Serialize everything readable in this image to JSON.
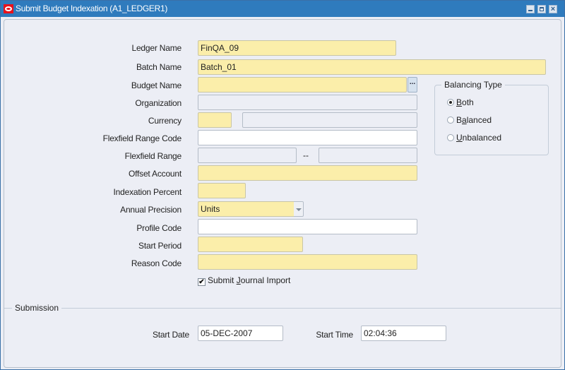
{
  "window": {
    "title": "Submit Budget Indexation (A1_LEDGER1)",
    "buttons": {
      "minimize": "minimize",
      "maximize": "maximize",
      "close": "×"
    }
  },
  "form": {
    "ledger_name": {
      "label": "Ledger Name",
      "value": "FinQA_09"
    },
    "batch_name": {
      "label": "Batch Name",
      "value": "Batch_01"
    },
    "budget_name": {
      "label": "Budget Name",
      "value": "",
      "lov_label": "..."
    },
    "organization": {
      "label": "Organization",
      "value": ""
    },
    "currency": {
      "label": "Currency",
      "value": "",
      "description": ""
    },
    "flexfield_range_code": {
      "label": "Flexfield Range Code",
      "value": ""
    },
    "flexfield_range": {
      "label": "Flexfield Range",
      "from": "",
      "separator": "--",
      "to": ""
    },
    "offset_account": {
      "label": "Offset Account",
      "value": ""
    },
    "indexation_percent": {
      "label": "Indexation Percent",
      "value": ""
    },
    "annual_precision": {
      "label": "Annual Precision",
      "value": "Units"
    },
    "profile_code": {
      "label": "Profile Code",
      "value": ""
    },
    "start_period": {
      "label": "Start Period",
      "value": ""
    },
    "reason_code": {
      "label": "Reason Code",
      "value": ""
    },
    "submit_journal_import": {
      "label_pre": "Submit ",
      "label_mn": "J",
      "label_post": "ournal Import",
      "checked": true,
      "check_glyph": "✔"
    }
  },
  "balancing_type": {
    "title": "Balancing Type",
    "options": [
      {
        "mn": "B",
        "rest": "oth",
        "pre": "",
        "checked": true
      },
      {
        "pre": "B",
        "mn": "a",
        "rest": "lanced",
        "checked": false
      },
      {
        "pre": "",
        "mn": "U",
        "rest": "nbalanced",
        "checked": false
      }
    ]
  },
  "submission": {
    "title": "Submission",
    "start_date": {
      "label": "Start Date",
      "value": "05-DEC-2007"
    },
    "start_time": {
      "label": "Start Time",
      "value": "02:04:36"
    }
  }
}
